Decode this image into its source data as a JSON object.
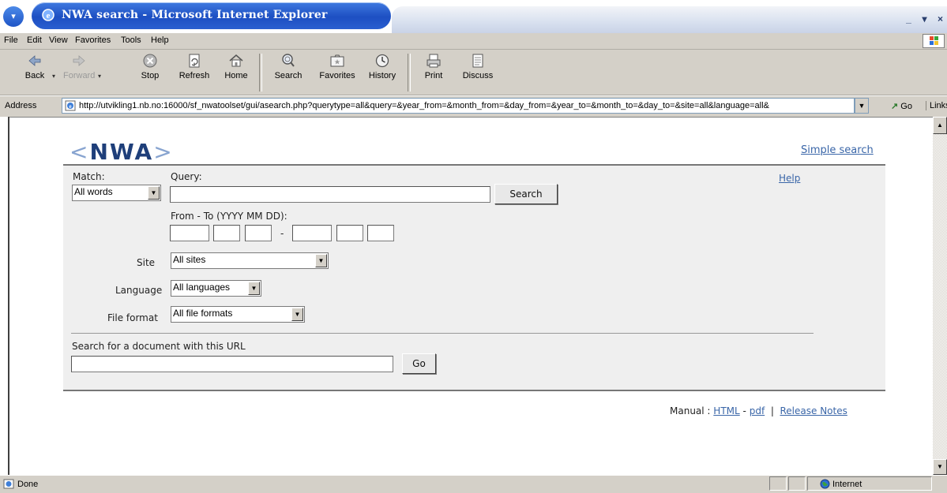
{
  "window": {
    "title": "NWA search - Microsoft Internet Explorer",
    "controls": {
      "minimize": "_",
      "restore": "▾",
      "close": "×"
    }
  },
  "menu": [
    "File",
    "Edit",
    "View",
    "Favorites",
    "Tools",
    "Help"
  ],
  "toolbar": {
    "back": "Back",
    "forward": "Forward",
    "stop": "Stop",
    "refresh": "Refresh",
    "home": "Home",
    "search": "Search",
    "favorites": "Favorites",
    "history": "History",
    "print": "Print",
    "discuss": "Discuss"
  },
  "address": {
    "label": "Address",
    "url": "http://utvikling1.nb.no:16000/sf_nwatoolset/gui/asearch.php?querytype=all&query=&year_from=&month_from=&day_from=&year_to=&month_to=&day_to=&site=all&language=all&",
    "go": "Go",
    "links": "Links"
  },
  "page": {
    "logo_open": "<",
    "logo_text": "NWA",
    "logo_close": ">",
    "simple_search": "Simple search",
    "help": "Help",
    "match_label": "Match:",
    "match_value": "All words",
    "query_label": "Query:",
    "query_value": "",
    "search_button": "Search",
    "date_label": "From - To (YYYY MM DD):",
    "date_separator": "-",
    "site_label": "Site",
    "site_value": "All sites",
    "language_label": "Language",
    "language_value": "All languages",
    "fileformat_label": "File format",
    "fileformat_value": "All file formats",
    "url_search_label": "Search for a document with this URL",
    "url_value": "",
    "go_button": "Go",
    "manual_prefix": "Manual :",
    "manual_html": "HTML",
    "manual_dash": "-",
    "manual_pdf": "pdf",
    "manual_sep": "|",
    "release_notes": "Release Notes"
  },
  "status": {
    "text": "Done",
    "zone": "Internet"
  },
  "colors": {
    "titlebar": "#1d4fc2",
    "chrome": "#d4d0c8",
    "link": "#3a66a8",
    "logo_dark": "#1f3f7a",
    "logo_light": "#88a4d0",
    "panel": "#efefef"
  }
}
